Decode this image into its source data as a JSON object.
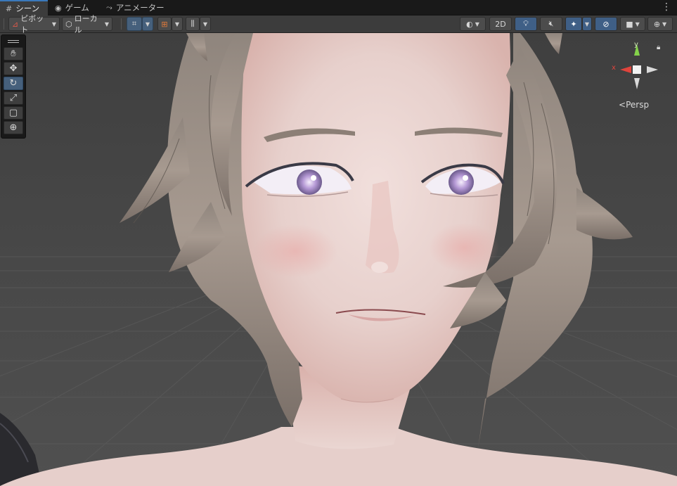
{
  "tabs": [
    {
      "label": "シーン",
      "icon": "grid-icon"
    },
    {
      "label": "ゲーム",
      "icon": "gamepad-icon"
    },
    {
      "label": "アニメーター",
      "icon": "animator-icon"
    }
  ],
  "toolbar": {
    "pivot_label": "ピボット",
    "local_label": "ローカル",
    "mode_2d_label": "2D"
  },
  "tools": [
    "hand-tool",
    "move-tool",
    "rotate-tool",
    "scale-tool",
    "rect-tool",
    "transform-tool"
  ],
  "selected_tool": "rotate-tool",
  "gizmo": {
    "projection_label": "Persp",
    "x_label": "x",
    "y_label": "y"
  },
  "colors": {
    "accent": "#46607c",
    "gizmo_x": "#e0443c",
    "gizmo_y": "#84d24a",
    "tab_highlight": "#3a79bb"
  }
}
